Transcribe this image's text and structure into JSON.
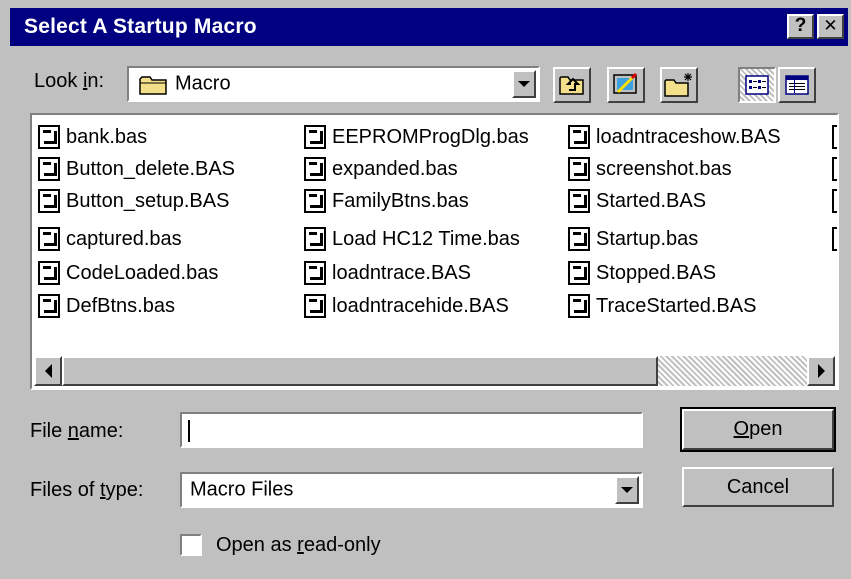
{
  "window": {
    "title": "Select A Startup Macro",
    "help_button": "?",
    "close_button": "✕"
  },
  "look_in": {
    "label_pre": "Look ",
    "label_access": "i",
    "label_post": "n:",
    "value": "Macro",
    "folder_icon": "folder-icon"
  },
  "toolbar": {
    "icons": [
      "up-one-level-icon",
      "desktop-icon",
      "new-folder-icon",
      "list-view-icon",
      "details-view-icon"
    ]
  },
  "files": {
    "columns": [
      [
        "bank.bas",
        "Button_delete.BAS",
        "Button_setup.BAS",
        "captured.bas",
        "CodeLoaded.bas",
        "DefBtns.bas"
      ],
      [
        "EEPROMProgDlg.bas",
        "expanded.bas",
        "FamilyBtns.bas",
        "Load HC12 Time.bas",
        "loadntrace.BAS",
        "loadntracehide.BAS"
      ],
      [
        "loadntraceshow.BAS",
        "screenshot.bas",
        "Started.BAS",
        "Startup.bas",
        "Stopped.BAS",
        "TraceStarted.BAS"
      ]
    ]
  },
  "file_name": {
    "label_pre": "File ",
    "label_access": "n",
    "label_post": "ame:",
    "value": ""
  },
  "file_type": {
    "label_pre": "Files of ",
    "label_access": "t",
    "label_post": "ype:",
    "value": "Macro Files"
  },
  "buttons": {
    "open_access": "O",
    "open_rest": "pen",
    "cancel": "Cancel"
  },
  "read_only": {
    "label_pre": "Open as ",
    "label_access": "r",
    "label_post": "ead-only",
    "checked": false
  }
}
